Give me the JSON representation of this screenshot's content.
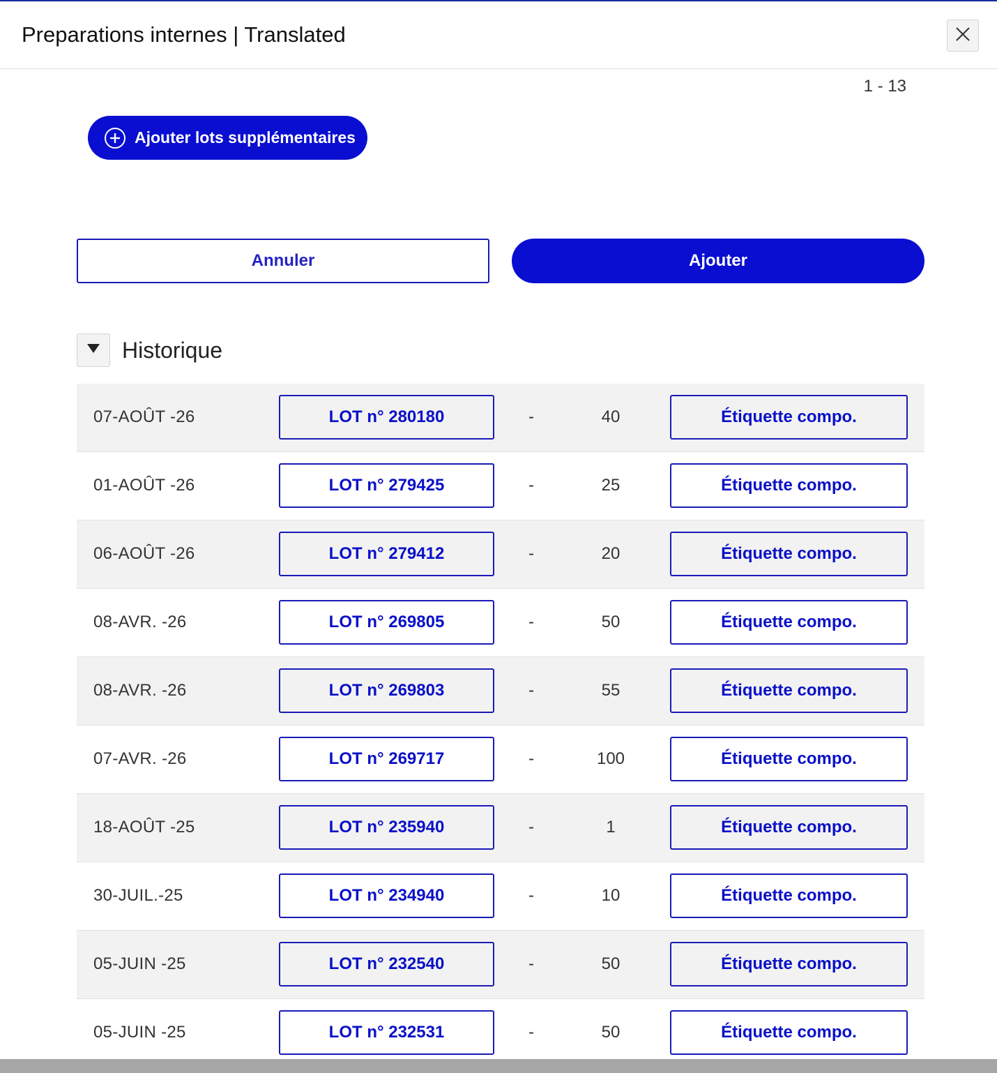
{
  "header": {
    "title": "Preparations internes | Translated",
    "close_icon": "close-icon"
  },
  "pagination": {
    "range": "1 - 13"
  },
  "actions": {
    "add_lots_label": "Ajouter lots supplémentaires",
    "add_lots_icon": "plus-circle-icon",
    "cancel_label": "Annuler",
    "confirm_label": "Ajouter"
  },
  "history": {
    "title": "Historique",
    "toggle_icon": "caret-down-icon",
    "rows": [
      {
        "date": "07-AOÛT -26",
        "lot": "LOT n° 280180",
        "dash": "-",
        "qty": "40",
        "label": "Étiquette compo."
      },
      {
        "date": "01-AOÛT -26",
        "lot": "LOT n° 279425",
        "dash": "-",
        "qty": "25",
        "label": "Étiquette compo."
      },
      {
        "date": "06-AOÛT -26",
        "lot": "LOT n° 279412",
        "dash": "-",
        "qty": "20",
        "label": "Étiquette compo."
      },
      {
        "date": "08-AVR. -26",
        "lot": "LOT n° 269805",
        "dash": "-",
        "qty": "50",
        "label": "Étiquette compo."
      },
      {
        "date": "08-AVR. -26",
        "lot": "LOT n° 269803",
        "dash": "-",
        "qty": "55",
        "label": "Étiquette compo."
      },
      {
        "date": "07-AVR. -26",
        "lot": "LOT n° 269717",
        "dash": "-",
        "qty": "100",
        "label": "Étiquette compo."
      },
      {
        "date": "18-AOÛT -25",
        "lot": "LOT n° 235940",
        "dash": "-",
        "qty": "1",
        "label": "Étiquette compo."
      },
      {
        "date": "30-JUIL.-25",
        "lot": "LOT n° 234940",
        "dash": "-",
        "qty": "10",
        "label": "Étiquette compo."
      },
      {
        "date": "05-JUIN -25",
        "lot": "LOT n° 232540",
        "dash": "-",
        "qty": "50",
        "label": "Étiquette compo."
      },
      {
        "date": "05-JUIN -25",
        "lot": "LOT n° 232531",
        "dash": "-",
        "qty": "50",
        "label": "Étiquette compo."
      }
    ]
  },
  "colors": {
    "primary": "#0a0ed0",
    "border_accent": "#1a1ab8",
    "row_alt": "#f2f2f2"
  }
}
